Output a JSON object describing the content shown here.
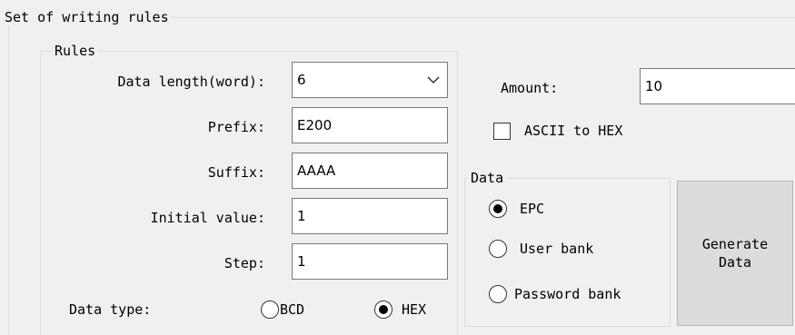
{
  "writing_rules": {
    "legend": "Set of writing rules",
    "rules": {
      "legend": "Rules",
      "data_length_label": "Data length(word):",
      "data_length_value": "6",
      "prefix_label": "Prefix:",
      "prefix_value": "E200",
      "suffix_label": "Suffix:",
      "suffix_value": "AAAA",
      "initial_value_label": "Initial value:",
      "initial_value_value": "1",
      "step_label": "Step:",
      "step_value": "1",
      "data_type_label": "Data type:",
      "data_type_options": [
        {
          "label": "BCD",
          "selected": false
        },
        {
          "label": "HEX",
          "selected": true
        }
      ]
    },
    "amount_label": "Amount:",
    "amount_value": "10",
    "ascii_to_hex_label": "ASCII to HEX",
    "ascii_to_hex_checked": false,
    "data_group": {
      "legend": "Data",
      "options": [
        {
          "label": "EPC",
          "selected": true
        },
        {
          "label": "User bank",
          "selected": false
        },
        {
          "label": "Password bank",
          "selected": false
        }
      ]
    },
    "generate_button_label": "Generate Data"
  }
}
